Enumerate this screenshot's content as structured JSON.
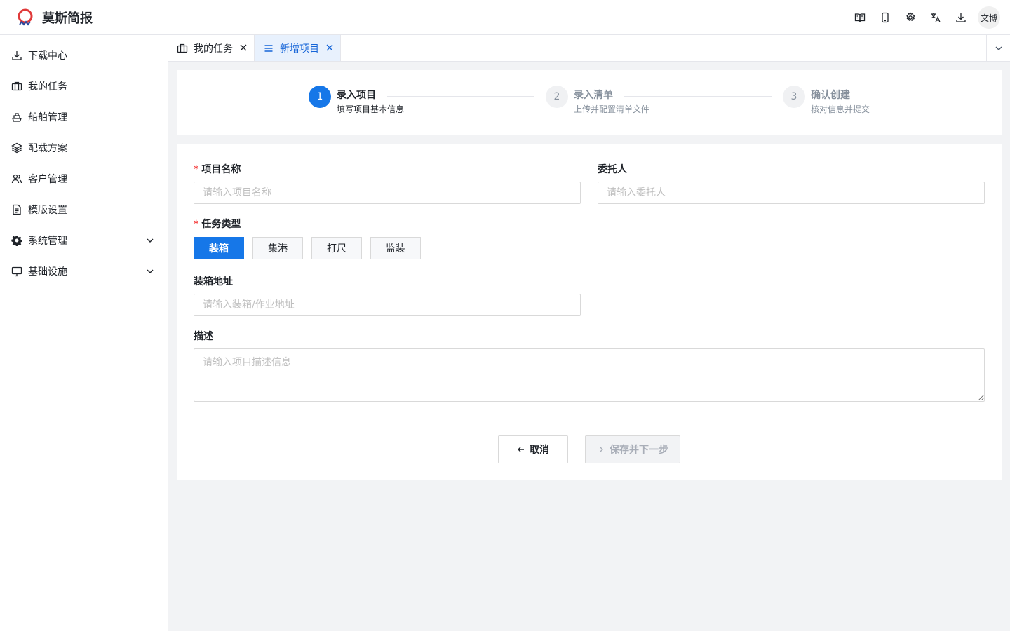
{
  "app": {
    "title": "莫斯简报"
  },
  "header": {
    "icons": [
      "book-icon",
      "mobile-icon",
      "settings-icon",
      "translate-icon",
      "download-icon"
    ],
    "user": "文博"
  },
  "sidebar": {
    "items": [
      {
        "label": "下载中心",
        "icon": "download-icon"
      },
      {
        "label": "我的任务",
        "icon": "briefcase-icon"
      },
      {
        "label": "船舶管理",
        "icon": "ship-icon"
      },
      {
        "label": "配载方案",
        "icon": "layers-icon"
      },
      {
        "label": "客户管理",
        "icon": "users-icon"
      },
      {
        "label": "模版设置",
        "icon": "document-icon"
      },
      {
        "label": "系统管理",
        "icon": "gear-icon",
        "expandable": true
      },
      {
        "label": "基础设施",
        "icon": "monitor-icon",
        "expandable": true
      }
    ]
  },
  "tabs": [
    {
      "label": "我的任务",
      "icon": "briefcase-icon",
      "active": false
    },
    {
      "label": "新增项目",
      "icon": "menu-icon",
      "active": true
    }
  ],
  "steps": [
    {
      "number": "1",
      "title": "录入项目",
      "desc": "填写项目基本信息",
      "status": "active"
    },
    {
      "number": "2",
      "title": "录入清单",
      "desc": "上传并配置清单文件",
      "status": "wait"
    },
    {
      "number": "3",
      "title": "确认创建",
      "desc": "核对信息并提交",
      "status": "wait"
    }
  ],
  "form": {
    "project_name": {
      "label": "项目名称",
      "required": "*",
      "placeholder": "请输入项目名称"
    },
    "client": {
      "label": "委托人",
      "placeholder": "请输入委托人"
    },
    "task_type": {
      "label": "任务类型",
      "required": "*",
      "options": [
        "装箱",
        "集港",
        "打尺",
        "监装"
      ],
      "selected": "装箱"
    },
    "address": {
      "label": "装箱地址",
      "placeholder": "请输入装箱/作业地址"
    },
    "description": {
      "label": "描述",
      "placeholder": "请输入项目描述信息"
    }
  },
  "actions": {
    "cancel": "取消",
    "next": "保存并下一步"
  },
  "colors": {
    "primary": "#1677e8",
    "required": "#f53f3f",
    "active_tab_bg": "#e8f1fd"
  }
}
